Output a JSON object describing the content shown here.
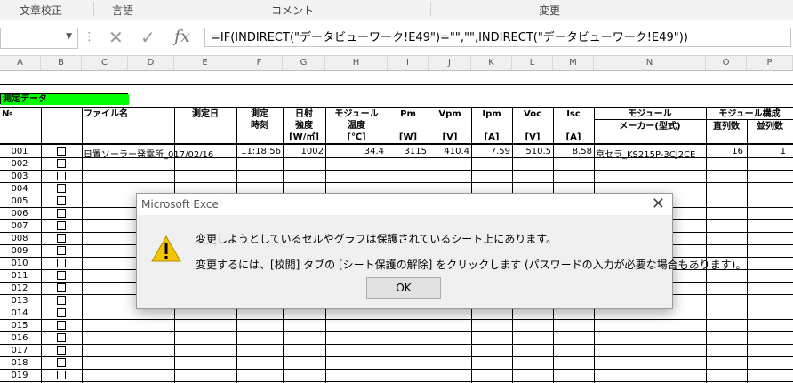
{
  "ribbon": {
    "groups": [
      "文章校正",
      "言語",
      "コメント",
      "変更"
    ]
  },
  "formula_bar": {
    "name_box": "",
    "cancel_icon": "x-icon",
    "enter_icon": "check-icon",
    "fx_label": "fx",
    "formula": "=IF(INDIRECT(\"データビューワーク!E49\")=\"\",\"\",INDIRECT(\"データビューワーク!E49\"))"
  },
  "columns": [
    "A",
    "B",
    "C",
    "D",
    "E",
    "F",
    "G",
    "H",
    "I",
    "J",
    "K",
    "L",
    "M",
    "N",
    "O",
    "P"
  ],
  "sheet": {
    "section_title": "測定データ",
    "section_color": "#00ff00",
    "headers": {
      "no": "№",
      "file_name": "ファイル名",
      "date": "測定日",
      "time": [
        "測定",
        "時刻"
      ],
      "irradiance": [
        "日射",
        "強度",
        "[W/㎡]"
      ],
      "module_temp": [
        "モジュール",
        "温度",
        "[℃]"
      ],
      "pm": [
        "Pm",
        "[W]"
      ],
      "vpm": [
        "Vpm",
        "[V]"
      ],
      "ipm": [
        "Ipm",
        "[A]"
      ],
      "voc": [
        "Voc",
        "[V]"
      ],
      "isc": [
        "Isc",
        "[A]"
      ],
      "module": "モジュール",
      "maker": "メーカー(型式)",
      "config": "モジュール構成",
      "series": "直列数",
      "parallel": "並列数"
    },
    "row1": {
      "no": "001",
      "file": "日置ソーラー発電所_017/02/16",
      "date": "",
      "time": "11:18:56",
      "irradiance": "1002",
      "temp": "34.4",
      "pm": "3115",
      "vpm": "410.4",
      "ipm": "7.59",
      "voc": "510.5",
      "isc": "8.58",
      "maker": "京セラ_KS215P-3CJ2CE",
      "series": "16",
      "parallel": "1"
    },
    "row_numbers": [
      "001",
      "002",
      "003",
      "004",
      "005",
      "006",
      "007",
      "008",
      "009",
      "010",
      "011",
      "012",
      "013",
      "014",
      "015",
      "016",
      "017",
      "018",
      "019"
    ]
  },
  "dialog": {
    "title": "Microsoft Excel",
    "icon": "warning-icon",
    "line1": "変更しようとしているセルやグラフは保護されているシート上にあります。",
    "line2": "変更するには、[校閲] タブの [シート保護の解除] をクリックします (パスワードの入力が必要な場合もあります)。",
    "ok_label": "OK"
  }
}
